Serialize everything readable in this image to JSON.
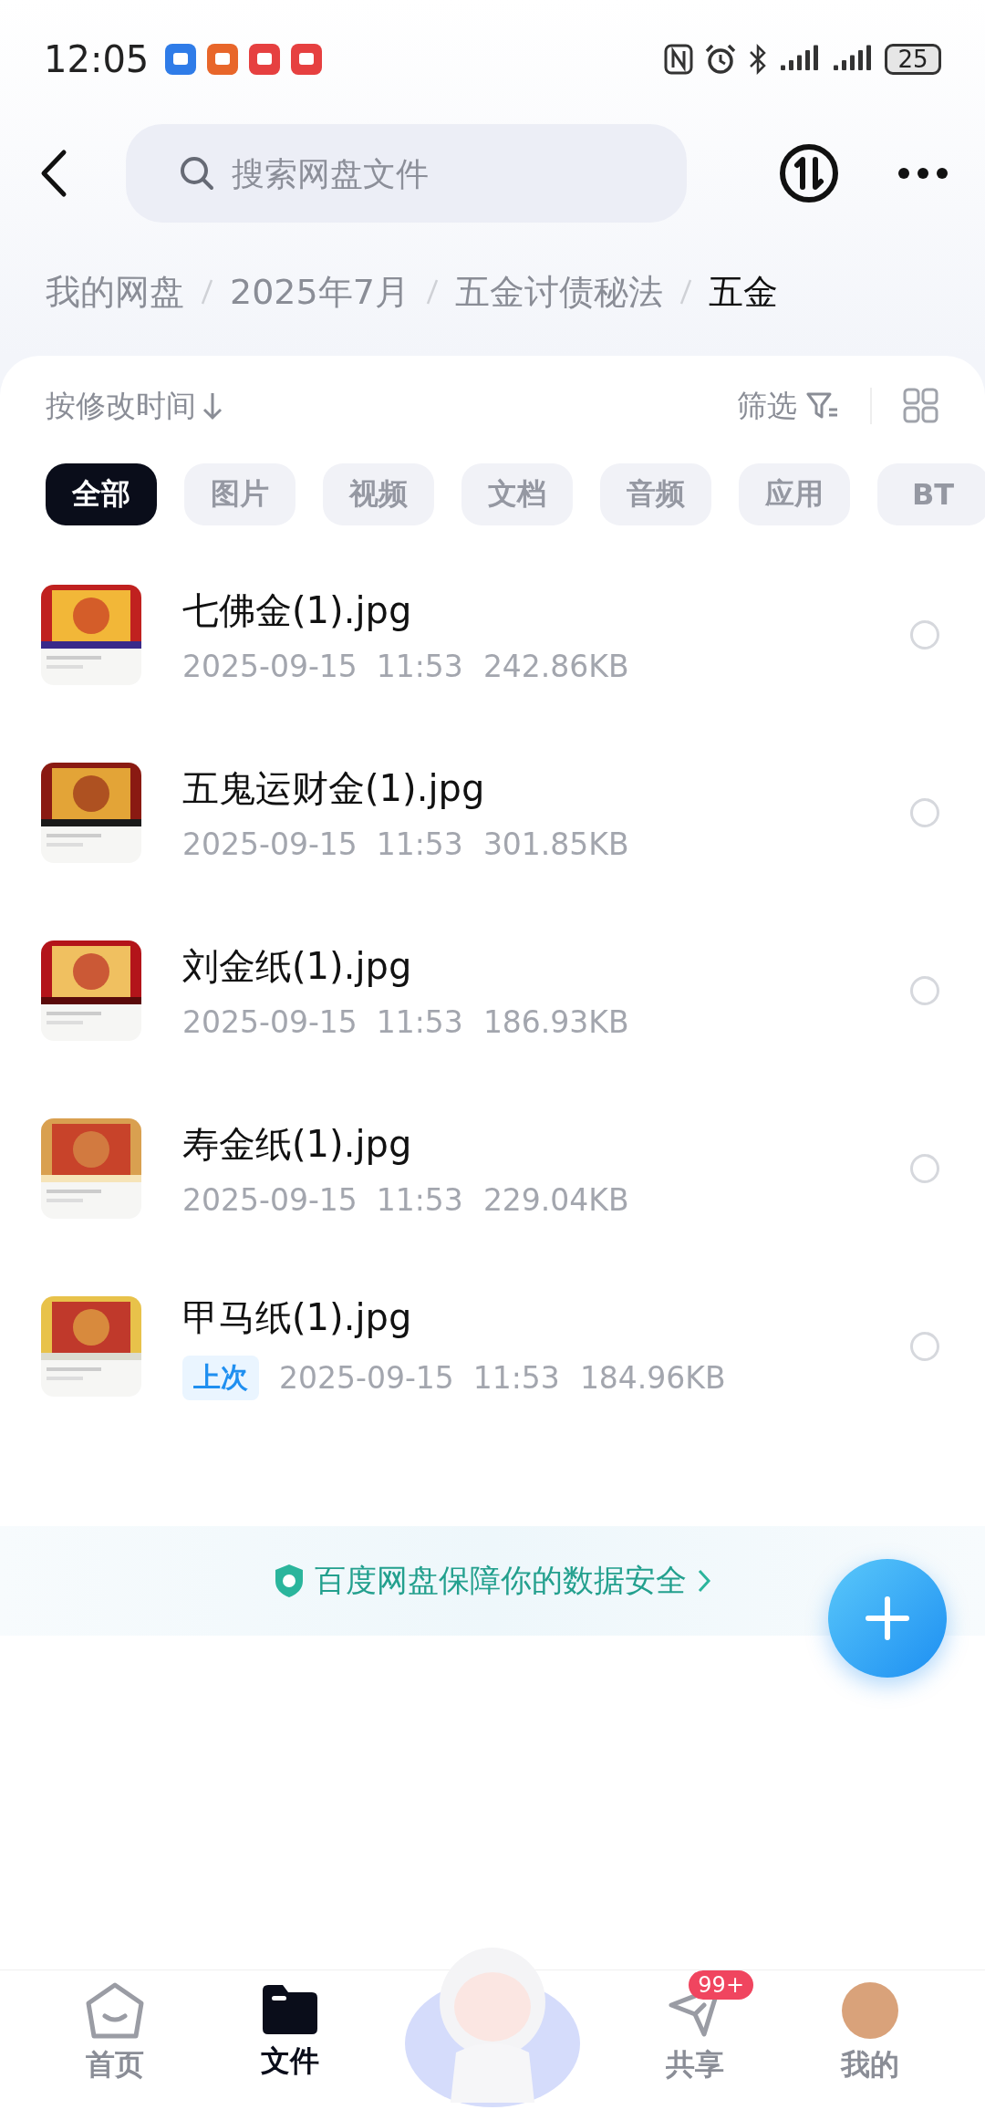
{
  "status_bar": {
    "time": "12:05",
    "battery": "25"
  },
  "header": {
    "search": {
      "placeholder": "搜索网盘文件"
    }
  },
  "breadcrumb": [
    {
      "label": "我的网盘",
      "current": false
    },
    {
      "label": "2025年7月",
      "current": false
    },
    {
      "label": "五金讨债秘法",
      "current": false
    },
    {
      "label": "五金",
      "current": true
    }
  ],
  "sort": {
    "label": "按修改时间"
  },
  "filter": {
    "label": "筛选"
  },
  "chips": [
    {
      "label": "全部",
      "selected": true
    },
    {
      "label": "图片",
      "selected": false
    },
    {
      "label": "视频",
      "selected": false
    },
    {
      "label": "文档",
      "selected": false
    },
    {
      "label": "音频",
      "selected": false
    },
    {
      "label": "应用",
      "selected": false
    },
    {
      "label": "BT",
      "selected": false
    }
  ],
  "files": [
    {
      "name": "七佛金(1).jpg",
      "modified": "2025-09-15  11:53",
      "size": "242.86KB",
      "selected": false
    },
    {
      "name": "五鬼运财金(1).jpg",
      "modified": "2025-09-15  11:53",
      "size": "301.85KB",
      "selected": false
    },
    {
      "name": "刘金纸(1).jpg",
      "modified": "2025-09-15  11:53",
      "size": "186.93KB",
      "selected": false
    },
    {
      "name": "寿金纸(1).jpg",
      "modified": "2025-09-15  11:53",
      "size": "229.04KB",
      "selected": false
    },
    {
      "name": "甲马纸(1).jpg",
      "tag": "上次",
      "modified": "2025-09-15  11:53",
      "size": "184.96KB",
      "selected": false
    }
  ],
  "security_notice": "百度网盘保障你的数据安全",
  "bottom_nav": [
    {
      "kind": "home",
      "label": "首页",
      "selected": false
    },
    {
      "kind": "files",
      "label": "文件",
      "selected": true
    },
    {
      "kind": "mascot"
    },
    {
      "kind": "share",
      "label": "共享",
      "selected": false,
      "badge": "99+"
    },
    {
      "kind": "profile",
      "label": "我的",
      "selected": false
    }
  ]
}
